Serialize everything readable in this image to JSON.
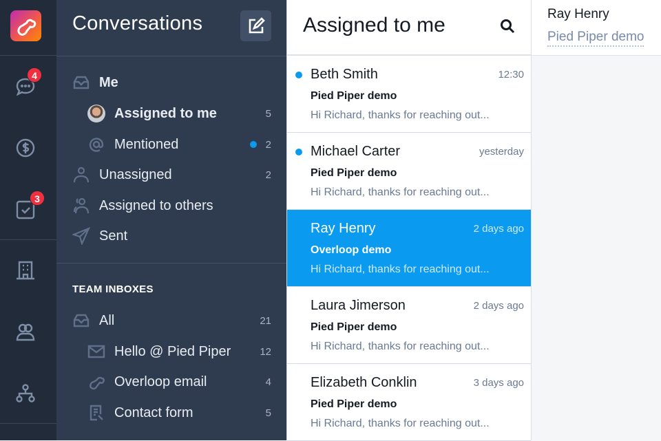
{
  "rail": {
    "badges": {
      "conversations": "4",
      "tasks": "3"
    }
  },
  "sidebar": {
    "title": "Conversations",
    "me": {
      "label": "Me",
      "items": [
        {
          "label": "Assigned to me",
          "count": "5"
        },
        {
          "label": "Mentioned",
          "count": "2"
        }
      ]
    },
    "items": [
      {
        "label": "Unassigned",
        "count": "2"
      },
      {
        "label": "Assigned to others"
      },
      {
        "label": "Sent"
      }
    ],
    "team_header": "TEAM INBOXES",
    "team": {
      "label": "All",
      "count": "21",
      "items": [
        {
          "label": "Hello @ Pied Piper",
          "count": "12"
        },
        {
          "label": "Overloop email",
          "count": "4"
        },
        {
          "label": "Contact form",
          "count": "5"
        }
      ]
    }
  },
  "list": {
    "title": "Assigned to me",
    "conversations": [
      {
        "name": "Beth Smith",
        "time": "12:30",
        "subject": "Pied Piper demo",
        "preview": "Hi Richard, thanks for reaching out...",
        "unread": true
      },
      {
        "name": "Michael Carter",
        "time": "yesterday",
        "subject": "Pied Piper demo",
        "preview": "Hi Richard, thanks for reaching out...",
        "unread": true
      },
      {
        "name": "Ray Henry",
        "time": "2 days ago",
        "subject": "Overloop demo",
        "preview": "Hi Richard, thanks for reaching out...",
        "selected": true
      },
      {
        "name": "Laura Jimerson",
        "time": "2 days ago",
        "subject": "Pied Piper demo",
        "preview": "Hi Richard, thanks for reaching out..."
      },
      {
        "name": "Elizabeth Conklin",
        "time": "3 days ago",
        "subject": "Pied Piper demo",
        "preview": "Hi Richard, thanks for reaching out..."
      }
    ]
  },
  "detail": {
    "name": "Ray Henry",
    "subject": "Pied Piper demo"
  },
  "colors": {
    "accent": "#0a9bf0",
    "sidebar": "#2f3c4f",
    "rail": "#222b39",
    "badge": "#f0303f"
  }
}
